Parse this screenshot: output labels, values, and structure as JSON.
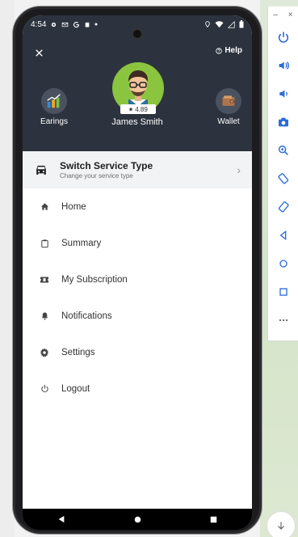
{
  "statusbar": {
    "time": "4:54"
  },
  "header": {
    "help_label": "Help",
    "user_name": "James Smith",
    "rating": "4.89",
    "earnings_label": "Earings",
    "wallet_label": "Wallet"
  },
  "switch_service": {
    "title": "Switch Service Type",
    "subtitle": "Change your service type"
  },
  "menu": {
    "items": [
      {
        "label": "Home",
        "icon": "home-icon"
      },
      {
        "label": "Summary",
        "icon": "clipboard-icon"
      },
      {
        "label": "My Subscription",
        "icon": "ticket-icon"
      },
      {
        "label": "Notifications",
        "icon": "bell-icon"
      },
      {
        "label": "Settings",
        "icon": "gear-icon"
      },
      {
        "label": "Logout",
        "icon": "power-icon"
      }
    ]
  },
  "colors": {
    "header_bg": "#2c333e",
    "avatar_bg": "#8bc43f",
    "switch_bg": "#f2f3f5"
  }
}
